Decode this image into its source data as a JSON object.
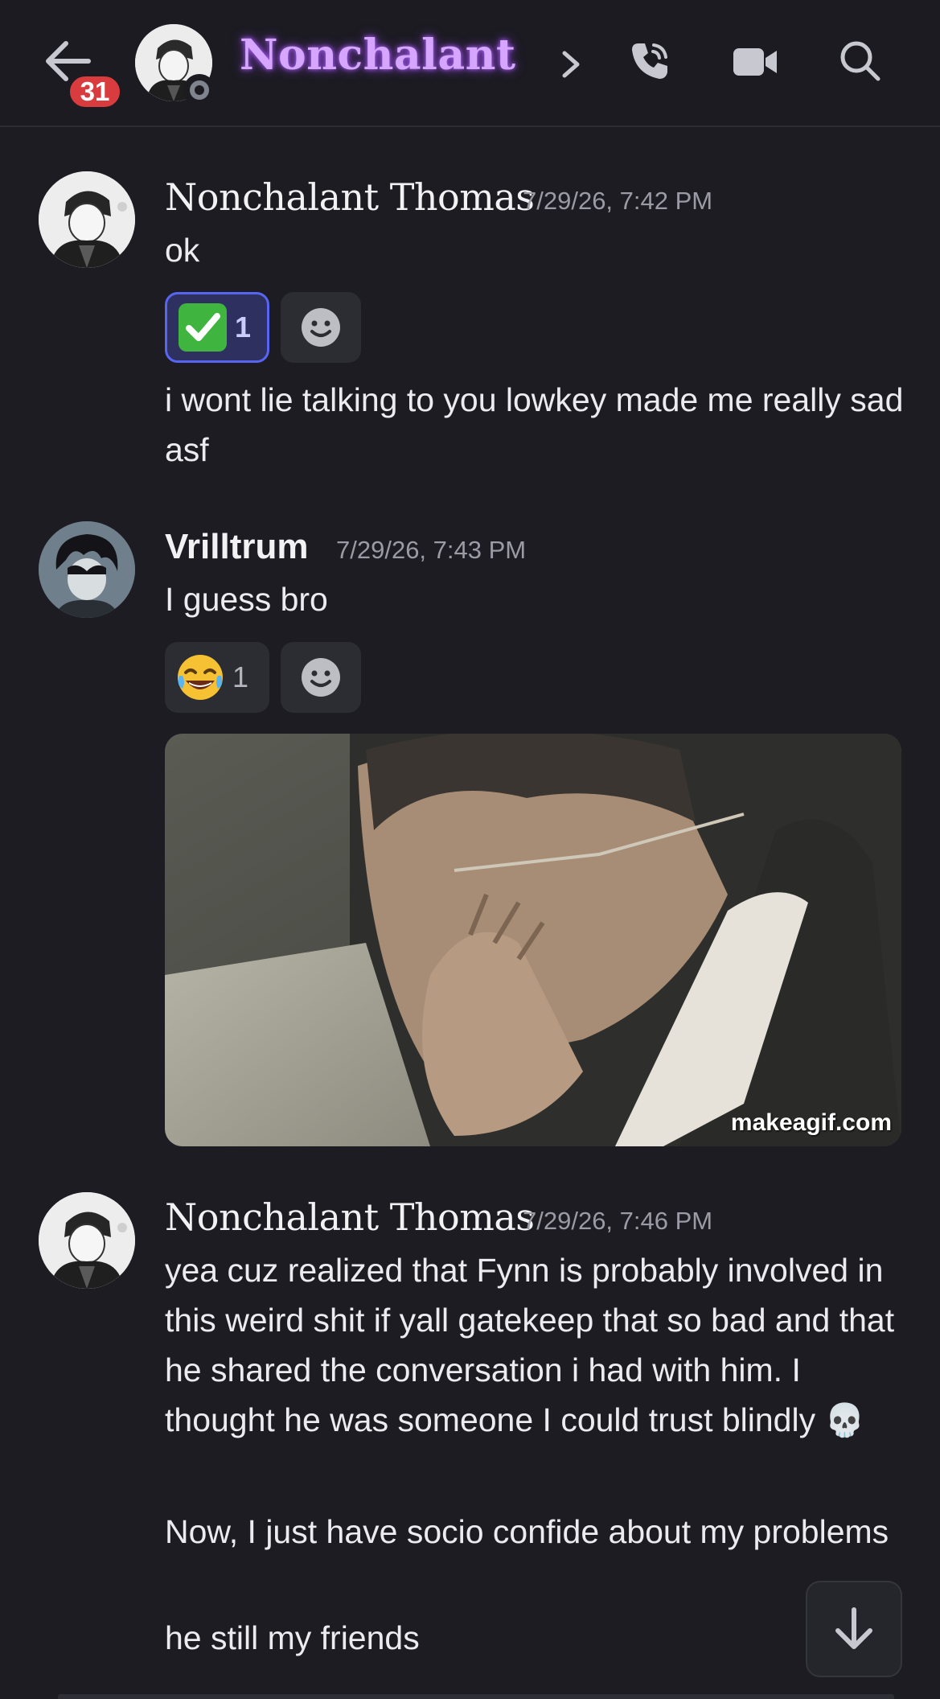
{
  "header": {
    "title": "Nonchalant",
    "unread_badge": "31"
  },
  "messages": [
    {
      "author": "Nonchalant Thomas",
      "timestamp": "7/29/26, 7:42 PM",
      "lines": [
        "ok",
        "i wont lie talking to you lowkey made me really sad asf"
      ],
      "reaction": {
        "emoji": "check-mark-button",
        "count": "1"
      }
    },
    {
      "author": "Vrilltrum",
      "timestamp": "7/29/26, 7:43 PM",
      "lines": [
        "I guess bro"
      ],
      "reaction": {
        "emoji": "face-with-tears-of-joy",
        "count": "1"
      },
      "gif_watermark": "makeagif.com"
    },
    {
      "author": "Nonchalant Thomas",
      "timestamp": "7/29/26, 7:46 PM",
      "lines": [
        "yea cuz realized that Fynn is probably involved in this weird shit if yall gatekeep that so bad and that he shared the conversation i had with him. I thought he was someone I could trust blindly",
        "Now, I just have socio  confide  about my problems",
        "he still my friends"
      ]
    }
  ],
  "colors": {
    "background": "#1c1c22",
    "title_glow": "#b066ff",
    "badge": "#d83c3e",
    "reaction_active_border": "#5865f2"
  }
}
